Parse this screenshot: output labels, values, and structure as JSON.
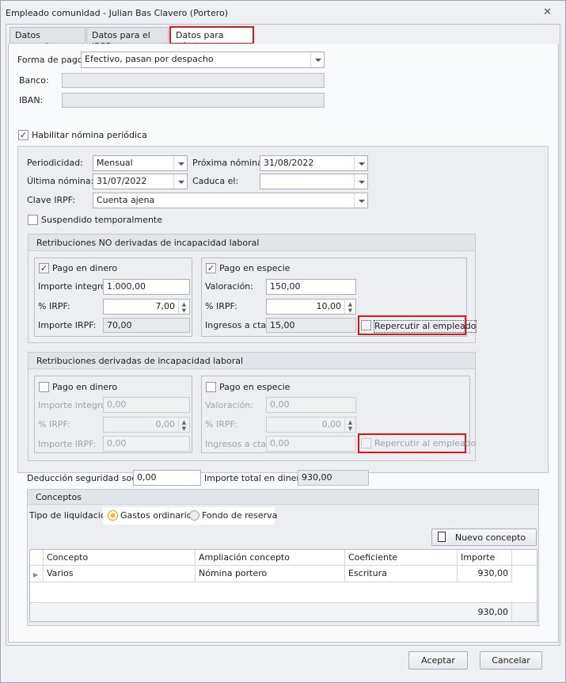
{
  "window": {
    "title": "Empleado comunidad - Julian Bas Clavero (Portero)",
    "close_icon": "close-icon"
  },
  "tabs": [
    {
      "label": "Datos generales"
    },
    {
      "label": "Datos para el IRPF"
    },
    {
      "label": "Datos para nómina",
      "active": true
    }
  ],
  "forma_pago": {
    "label": "Forma de pago:",
    "value": "Efectivo, pasan por despacho"
  },
  "banco": {
    "label": "Banco:",
    "value": ""
  },
  "iban": {
    "label": "IBAN:",
    "value": ""
  },
  "habilitar": {
    "label": "Habilitar nómina periódica",
    "checked": true
  },
  "periodicidad": {
    "label": "Periodicidad:",
    "value": "Mensual"
  },
  "proxima": {
    "label": "Próxima nómina:",
    "value": "31/08/2022"
  },
  "ultima": {
    "label": "Última nómina:",
    "value": "31/07/2022"
  },
  "caduca": {
    "label": "Caduca el:",
    "value": ""
  },
  "clave_irpf": {
    "label": "Clave IRPF:",
    "value": "Cuenta ajena"
  },
  "suspendido": {
    "label": "Suspendido temporalmente",
    "checked": false
  },
  "no_derivadas": {
    "title": "Retribuciones NO derivadas de incapacidad laboral",
    "dinero": {
      "label": "Pago en dinero",
      "checked": true,
      "importe_integro_label": "Importe integro:",
      "importe_integro": "1.000,00",
      "irpf_label": "% IRPF:",
      "irpf": "7,00",
      "importe_irpf_label": "Importe IRPF:",
      "importe_irpf": "70,00"
    },
    "especie": {
      "label": "Pago en especie",
      "checked": true,
      "valoracion_label": "Valoración:",
      "valoracion": "150,00",
      "irpf_label": "% IRPF:",
      "irpf": "10,00",
      "ingresos_label": "Ingresos a cta:",
      "ingresos": "15,00",
      "repercutir_label": "Repercutir al empleado",
      "repercutir": false
    }
  },
  "derivadas": {
    "title": "Retribuciones derivadas de incapacidad laboral",
    "dinero": {
      "label": "Pago en dinero",
      "checked": false,
      "importe_integro_label": "Importe integro:",
      "importe_integro": "0,00",
      "irpf_label": "% IRPF:",
      "irpf": "0,00",
      "importe_irpf_label": "Importe IRPF:",
      "importe_irpf": "0,00"
    },
    "especie": {
      "label": "Pago en especie",
      "checked": false,
      "valoracion_label": "Valoración:",
      "valoracion": "0,00",
      "irpf_label": "% IRPF:",
      "irpf": "0,00",
      "ingresos_label": "Ingresos a cta:",
      "ingresos": "0,00",
      "repercutir_label": "Repercutir al empleado",
      "repercutir": false
    }
  },
  "deduccion": {
    "label": "Deducción seguridad social:",
    "value": "0,00"
  },
  "importe_total": {
    "label": "Importe total en dinero:",
    "value": "930,00"
  },
  "conceptos": {
    "title": "Conceptos",
    "tipo_label": "Tipo de liquidación:",
    "options": [
      {
        "label": "Gastos ordinarios",
        "selected": true
      },
      {
        "label": "Fondo de reserva",
        "selected": false
      }
    ],
    "nuevo_label": "Nuevo concepto",
    "columns": [
      "Concepto",
      "Ampliación concepto",
      "Coeficiente",
      "Importe"
    ],
    "rows": [
      {
        "concepto": "Varios",
        "ampliacion": "Nómina portero",
        "coeficiente": "Escritura",
        "importe": "930,00"
      }
    ],
    "total": "930,00"
  },
  "footer": {
    "accept": "Aceptar",
    "cancel": "Cancelar"
  }
}
